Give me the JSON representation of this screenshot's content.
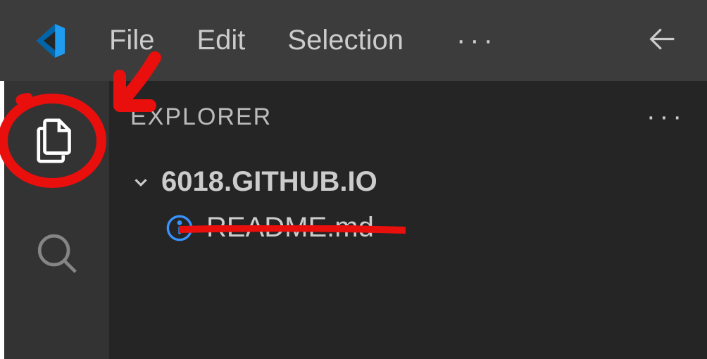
{
  "menu": {
    "items": [
      "File",
      "Edit",
      "Selection"
    ],
    "ellipsis": "···"
  },
  "explorer": {
    "title": "EXPLORER",
    "ellipsis": "···",
    "folder_name": "6018.GITHUB.IO",
    "files": [
      {
        "name": "README.md",
        "icon": "info-icon"
      }
    ]
  },
  "colors": {
    "annotation": "#e80f0d",
    "info_icon": "#3794ff",
    "logo_blue": "#0065a9",
    "logo_light": "#1f9cf0"
  }
}
